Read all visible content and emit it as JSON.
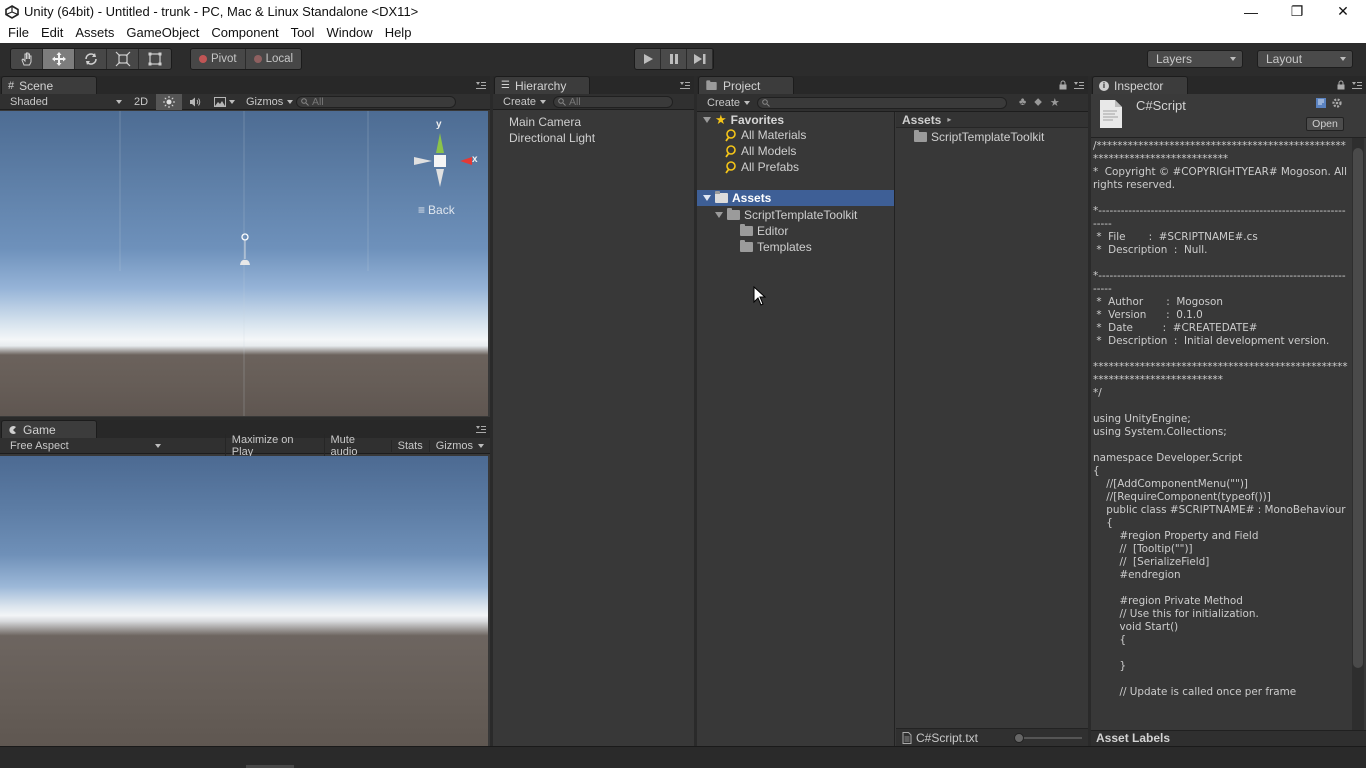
{
  "window": {
    "title": "Unity (64bit) - Untitled - trunk - PC, Mac & Linux Standalone <DX11>",
    "minimize": "—",
    "maximize": "❐",
    "close": "✕"
  },
  "menu": [
    "File",
    "Edit",
    "Assets",
    "GameObject",
    "Component",
    "Tool",
    "Window",
    "Help"
  ],
  "toolbar": {
    "pivot": "Pivot",
    "local": "Local",
    "layers": "Layers",
    "layout": "Layout"
  },
  "scene": {
    "tab": "Scene",
    "shading": "Shaded",
    "mode_2d": "2D",
    "gizmos": "Gizmos",
    "search_placeholder": "All",
    "gizmo_y": "y",
    "gizmo_x": "x",
    "back_label": "Back"
  },
  "game": {
    "tab": "Game",
    "aspect": "Free Aspect",
    "maximize_on_play": "Maximize on Play",
    "mute_audio": "Mute audio",
    "stats": "Stats",
    "gizmos": "Gizmos"
  },
  "hierarchy": {
    "tab": "Hierarchy",
    "create": "Create",
    "search_placeholder": "All",
    "items": [
      "Main Camera",
      "Directional Light"
    ]
  },
  "project": {
    "tab": "Project",
    "create": "Create",
    "favorites": "Favorites",
    "favorite_items": [
      "All Materials",
      "All Models",
      "All Prefabs"
    ],
    "assets_root": "Assets",
    "tree": [
      "ScriptTemplateToolkit",
      "Editor",
      "Templates"
    ],
    "breadcrumb": "Assets",
    "content_items": [
      "ScriptTemplateToolkit"
    ],
    "selected_file": "C#Script.txt"
  },
  "inspector": {
    "tab": "Inspector",
    "asset_name": "C#Script",
    "open_button": "Open",
    "asset_labels": "Asset Labels",
    "code": "/**************************************************************************\n*  Copyright © #COPYRIGHTYEAR# Mogoson. All rights reserved.\n\n*-----------------------------------------------------------------------\n *  File       :  #SCRIPTNAME#.cs\n *  Description  :  Null.\n\n*-----------------------------------------------------------------------\n *  Author       :  Mogoson\n *  Version      :  0.1.0\n *  Date         :  #CREATEDATE#\n *  Description  :  Initial development version.\n\n**************************************************************************\n*/\n\nusing UnityEngine;\nusing System.Collections;\n\nnamespace Developer.Script\n{\n    //[AddComponentMenu(\"\")]\n    //[RequireComponent(typeof())]\n    public class #SCRIPTNAME# : MonoBehaviour\n    {\n        #region Property and Field\n        //  [Tooltip(\"\")]\n        //  [SerializeField]\n        #endregion\n\n        #region Private Method\n        // Use this for initialization.\n        void Start()\n        {\n\n        }\n\n        // Update is called once per frame"
  },
  "colors": {
    "selection": "#3e5f96",
    "panel": "#383838",
    "toolbar": "#2c2c2c"
  }
}
